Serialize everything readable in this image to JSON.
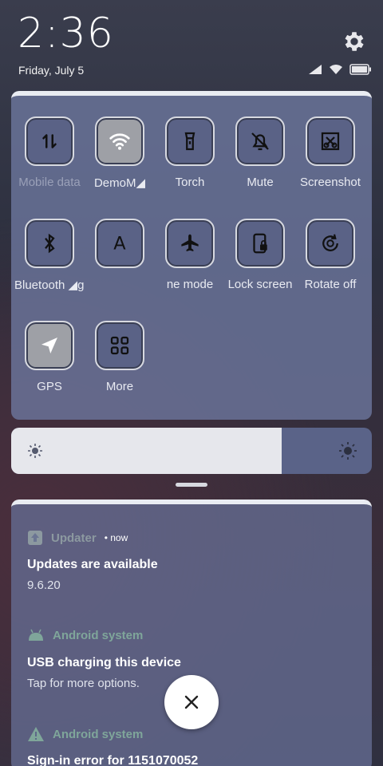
{
  "status_bar": {
    "time": "2:36",
    "date": "Friday, July 5"
  },
  "quick_settings": {
    "tiles": [
      {
        "label": "Mobile data",
        "icon": "mobile-data-icon",
        "active": false,
        "dim": true
      },
      {
        "label": "DemoM◢",
        "icon": "wifi-icon",
        "active": true,
        "dim": false
      },
      {
        "label": "Torch",
        "icon": "torch-icon",
        "active": false,
        "dim": false
      },
      {
        "label": "Mute",
        "icon": "bell-off-icon",
        "active": false,
        "dim": false
      },
      {
        "label": "Screenshot",
        "icon": "screenshot-icon",
        "active": false,
        "dim": false
      },
      {
        "label": "Bluetooth ◢ghtness",
        "icon": "bluetooth-icon",
        "active": false,
        "dim": false
      },
      {
        "label": "",
        "icon": "auto-brightness-icon",
        "active": false,
        "dim": false
      },
      {
        "label": "ne mode",
        "icon": "airplane-icon",
        "active": false,
        "dim": false
      },
      {
        "label": "Lock screen",
        "icon": "lock-screen-icon",
        "active": false,
        "dim": false
      },
      {
        "label": "Rotate off",
        "icon": "rotate-icon",
        "active": false,
        "dim": false
      },
      {
        "label": "GPS",
        "icon": "gps-icon",
        "active": true,
        "dim": false
      },
      {
        "label": "More",
        "icon": "more-grid-icon",
        "active": false,
        "dim": false
      }
    ]
  },
  "brightness": {
    "level": 0.75
  },
  "notifications": [
    {
      "app": "Updater",
      "time": "• now",
      "title": "Updates are available",
      "text": "9.6.20"
    },
    {
      "app": "Android system",
      "time": "",
      "title": "USB charging this device",
      "text": "Tap for more options."
    },
    {
      "app": "Android system",
      "time": "",
      "title": "Sign-in error for 1151070052",
      "text": ""
    }
  ],
  "colors": {
    "accent": "#5a6388",
    "panel": "#6e78a0",
    "muted_app": "#8c99a0"
  }
}
